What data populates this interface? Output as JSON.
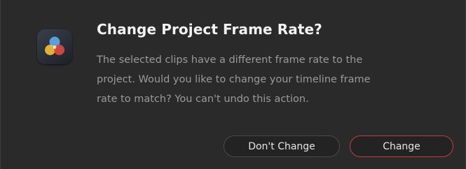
{
  "dialog": {
    "title": "Change Project Frame Rate?",
    "message_lines": [
      "The selected clips have a different frame rate to the",
      "project. Would you like to change your timeline frame",
      "rate to match? You can't undo this action."
    ],
    "icon": "davinci-resolve-app-icon"
  },
  "buttons": {
    "secondary_label": "Don't Change",
    "primary_label": "Change"
  },
  "colors": {
    "primary_accent": "#c63b3f",
    "background": "#2a2a2b"
  }
}
